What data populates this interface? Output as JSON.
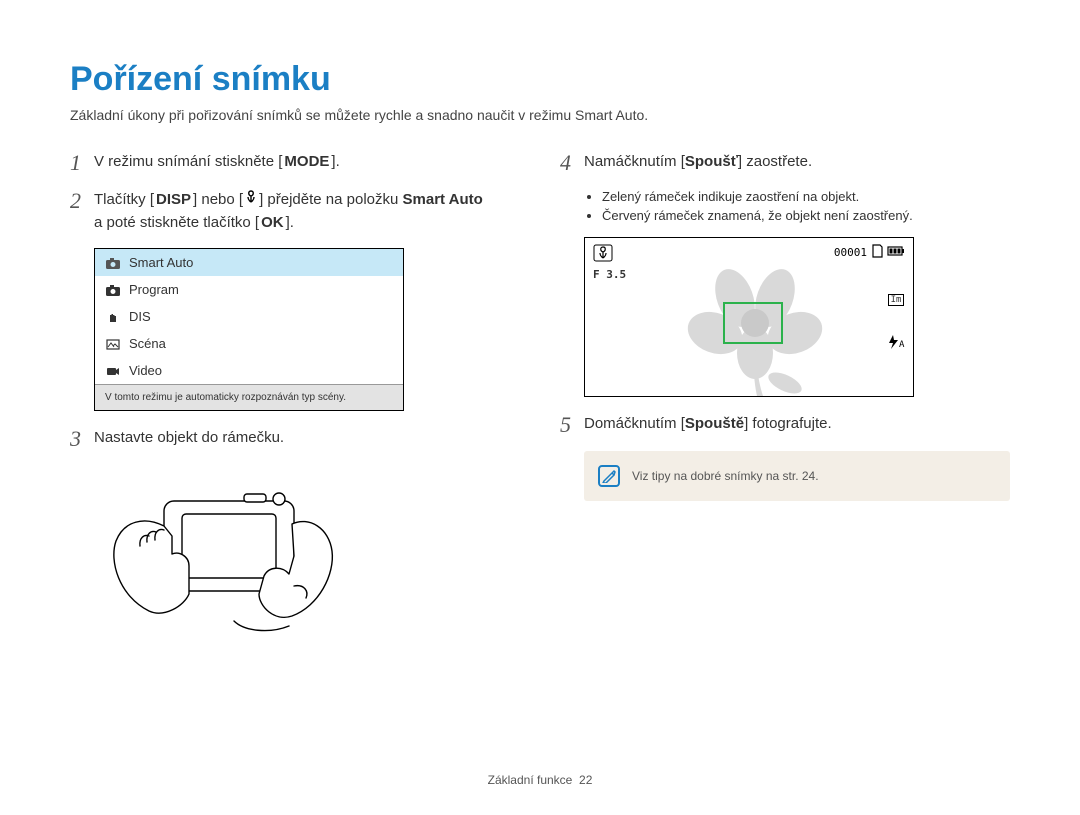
{
  "title": "Pořízení snímku",
  "subtitle": "Základní úkony při pořizování snímků se můžete rychle a snadno naučit v režimu Smart Auto.",
  "steps": {
    "s1": {
      "num": "1",
      "pre": "V režimu snímání stiskněte [",
      "btn": "MODE",
      "post": "]."
    },
    "s2": {
      "num": "2",
      "pre": "Tlačítky [",
      "btnA": "DISP",
      "mid": "] nebo [",
      "btnB_icon": "macro-icon",
      "mid2": "] přejděte na položku ",
      "bold": "Smart Auto",
      "line2pre": "a poté stiskněte tlačítko [",
      "btnC": "OK",
      "line2post": "]."
    },
    "s3": {
      "num": "3",
      "text": "Nastavte objekt do rámečku."
    },
    "s4": {
      "num": "4",
      "pre": "Namáčknutím [",
      "bold": "Spoušť",
      "post": "] zaostřete."
    },
    "s5": {
      "num": "5",
      "pre": "Domáčknutím [",
      "bold": "Spouště",
      "post": "] fotografujte."
    }
  },
  "bullets": {
    "b1": "Zelený rámeček indikuje zaostření na objekt.",
    "b2": "Červený rámeček znamená, že objekt není zaostřený."
  },
  "menu": {
    "items": [
      "Smart Auto",
      "Program",
      "DIS",
      "Scéna",
      "Video"
    ],
    "hint": "V tomto režimu je automaticky rozpoznáván typ scény."
  },
  "lcd": {
    "counter": "00001",
    "fvalue": "F 3.5",
    "im": "Im",
    "flash": "✱A"
  },
  "tip": {
    "text": "Viz tipy na dobré snímky na str. 24."
  },
  "footer": {
    "label": "Základní funkce",
    "page": "22"
  }
}
